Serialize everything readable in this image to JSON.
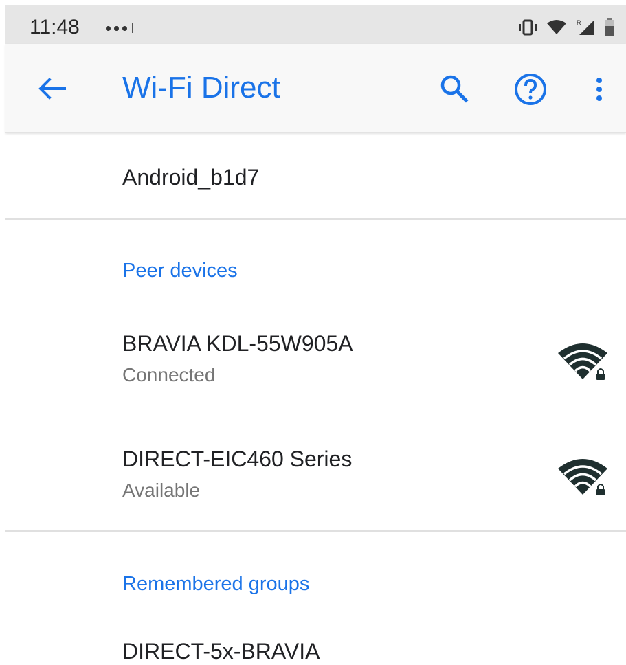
{
  "status_bar": {
    "time": "11:48"
  },
  "app_bar": {
    "title": "Wi-Fi Direct",
    "back_icon": "arrow-back-icon",
    "search_icon": "search-icon",
    "help_icon": "help-circle-icon",
    "more_icon": "more-vert-icon"
  },
  "device": {
    "name": "Android_b1d7"
  },
  "peer_section": {
    "header": "Peer devices",
    "items": [
      {
        "name": "BRAVIA KDL-55W905A",
        "status": "Connected",
        "icon": "wifi-lock-icon"
      },
      {
        "name": "DIRECT-EIC460 Series",
        "status": "Available",
        "icon": "wifi-lock-icon"
      }
    ]
  },
  "groups_section": {
    "header": "Remembered groups",
    "items": [
      {
        "name": "DIRECT-5x-BRAVIA"
      }
    ]
  },
  "colors": {
    "accent": "#1a73e8",
    "primary_text": "#202124",
    "secondary_text": "#757575",
    "status_bar_bg": "#e6e6e6",
    "app_bar_bg": "#f8f8f8",
    "icon_dark": "#1f2f2f"
  }
}
